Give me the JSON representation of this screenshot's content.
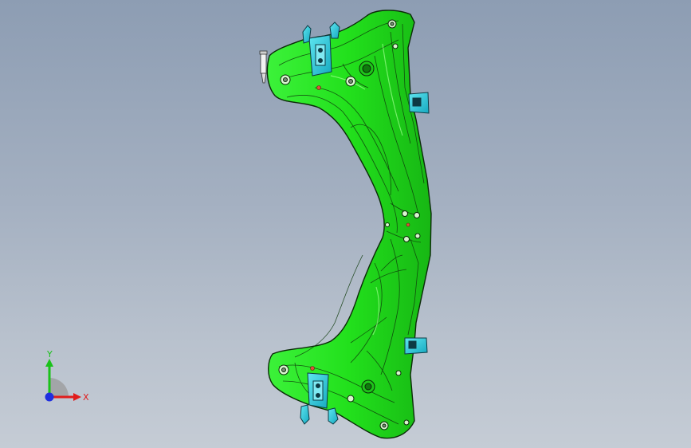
{
  "viewport": {
    "background_top": "#8d9db3",
    "background_bottom": "#c5ccd5"
  },
  "model": {
    "body_color": "#22e01c",
    "edge_color": "#0b2a08",
    "bracket_color": "#27c9d8",
    "pin_color": "#e6e6e6"
  },
  "triad": {
    "x_label": "X",
    "y_label": "Y",
    "x_color": "#e11c1c",
    "y_color": "#19c219",
    "z_color": "#1f2fe0"
  }
}
